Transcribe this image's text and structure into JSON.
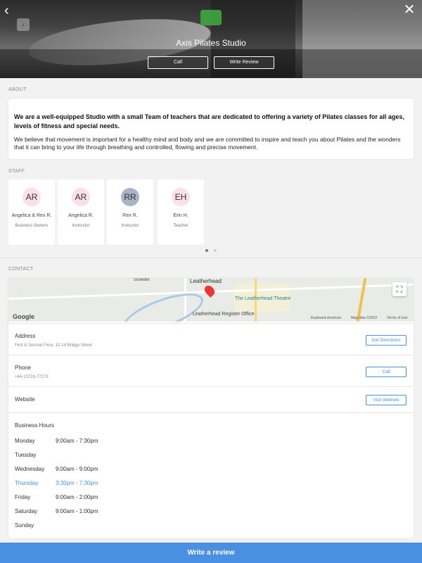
{
  "hero": {
    "studio_name": "Axis Pilates Studio",
    "call_label": "Call",
    "review_label": "Write Review",
    "back_glyph": "‹",
    "close_glyph": "✕",
    "nav_glyph": "‹"
  },
  "about": {
    "section_label": "ABOUT",
    "lead": "We are a well-equipped Studio with a small Team of teachers that are dedicated to offering a variety of Pilates classes for all ages, levels of fitness and special needs.",
    "body": "We believe that movement is important for a healthy mind and body and we are committed to inspire and teach you about Pilates and the wonders that it can bring to your life through breathing and controlled, flowing and precise movement."
  },
  "staff": {
    "section_label": "STAFF",
    "members": [
      {
        "initials": "AR",
        "name": "Angelica & Rex R.",
        "role": "Business Owners",
        "color": "#fbe0ea"
      },
      {
        "initials": "AR",
        "name": "Angelica R.",
        "role": "Instructor",
        "color": "#fbe0ea"
      },
      {
        "initials": "RR",
        "name": "Rex R.",
        "role": "Instructor",
        "color": "#a9b4c8"
      },
      {
        "initials": "EH",
        "name": "Erin H.",
        "role": "Teacher",
        "color": "#fbe0ea"
      }
    ]
  },
  "contact": {
    "section_label": "CONTACT",
    "map": {
      "town": "Leatherhead",
      "theatre": "The Leatherhead Theatre",
      "register": "Leatherhead Register Office",
      "screwfix": "Screwfix",
      "google": "Google",
      "shortcuts": "Keyboard shortcuts",
      "map_data": "Map data ©2022",
      "terms": "Terms of Use",
      "fullscreen_glyph": "⛶"
    },
    "address": {
      "title": "Address",
      "value": "First & Second Floor, 12-14 Bridge Street",
      "button": "Get Directions"
    },
    "phone": {
      "title": "Phone",
      "value": "+44-13728-77273",
      "button": "Call"
    },
    "website": {
      "title": "Website",
      "button": "Visit Website"
    },
    "hours": {
      "title": "Business Hours",
      "days": [
        {
          "day": "Monday",
          "time": "9:00am - 7:30pm"
        },
        {
          "day": "Tuesday",
          "time": ""
        },
        {
          "day": "Wednesday",
          "time": "9:00am - 9:00pm"
        },
        {
          "day": "Thursday",
          "time": "3:30pm - 7:30pm"
        },
        {
          "day": "Friday",
          "time": "9:00am - 2:00pm"
        },
        {
          "day": "Saturday",
          "time": "9:00am - 1:00pm"
        },
        {
          "day": "Sunday",
          "time": ""
        }
      ],
      "today_index": 3
    }
  },
  "footer": {
    "write_review": "Write a review"
  },
  "colors": {
    "accent": "#4a90e2",
    "link": "#4a90d9",
    "pin": "#e33333"
  }
}
